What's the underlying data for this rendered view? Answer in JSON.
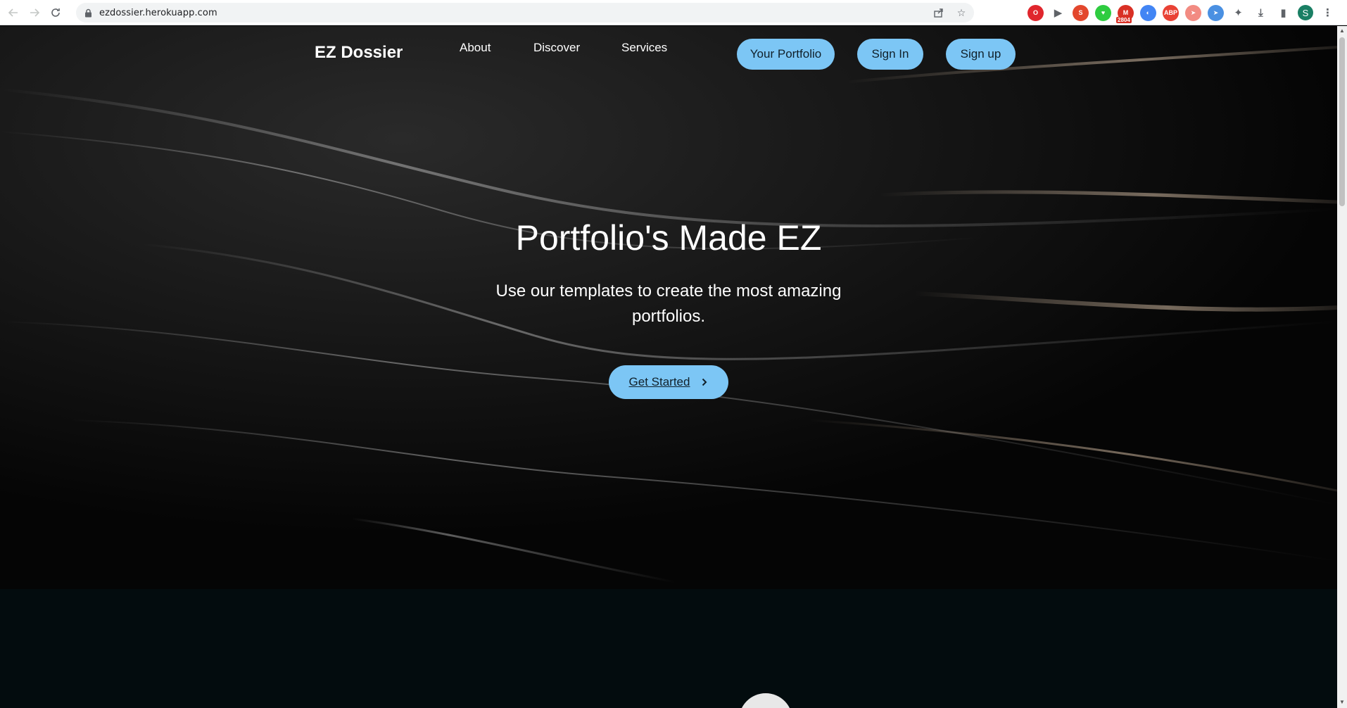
{
  "browser": {
    "url": "ezdossier.herokuapp.com",
    "profile_initial": "S",
    "extensions": [
      {
        "name": "opera-icon",
        "color": "#e0262d",
        "glyph": "O"
      },
      {
        "name": "video-icon",
        "color": "#5f6368",
        "glyph": "▶"
      },
      {
        "name": "shield-icon",
        "color": "#e3472d",
        "glyph": "S"
      },
      {
        "name": "heart-icon",
        "color": "#2ecc40",
        "glyph": "♥"
      },
      {
        "name": "gmail-icon",
        "color": "#d93025",
        "glyph": "M",
        "badge": "2804"
      },
      {
        "name": "color-wheel-icon",
        "color": "#4285f4",
        "glyph": "◐"
      },
      {
        "name": "adblock-icon",
        "color": "#e94235",
        "glyph": "ABP"
      },
      {
        "name": "send-pink-icon",
        "color": "#f28b82",
        "glyph": "➤"
      },
      {
        "name": "send-blue-icon",
        "color": "#4a90e2",
        "glyph": "➤"
      },
      {
        "name": "puzzle-icon",
        "color": "#5f6368",
        "glyph": "✦"
      },
      {
        "name": "download-icon",
        "color": "#5f6368",
        "glyph": "⤓"
      },
      {
        "name": "side-panel-icon",
        "color": "#5f6368",
        "glyph": "▮"
      }
    ]
  },
  "site": {
    "brand": "EZ Dossier",
    "nav": [
      "About",
      "Discover",
      "Services"
    ],
    "buttons": {
      "portfolio": "Your Portfolio",
      "signin": "Sign In",
      "signup": "Sign up"
    }
  },
  "hero": {
    "title": "Portfolio's Made EZ",
    "subtitle": "Use our templates to create the most amazing portfolios.",
    "cta": "Get Started"
  },
  "colors": {
    "accent": "#7cc6f5",
    "hero_bg": "#060606",
    "section_bg": "#030c0e"
  }
}
